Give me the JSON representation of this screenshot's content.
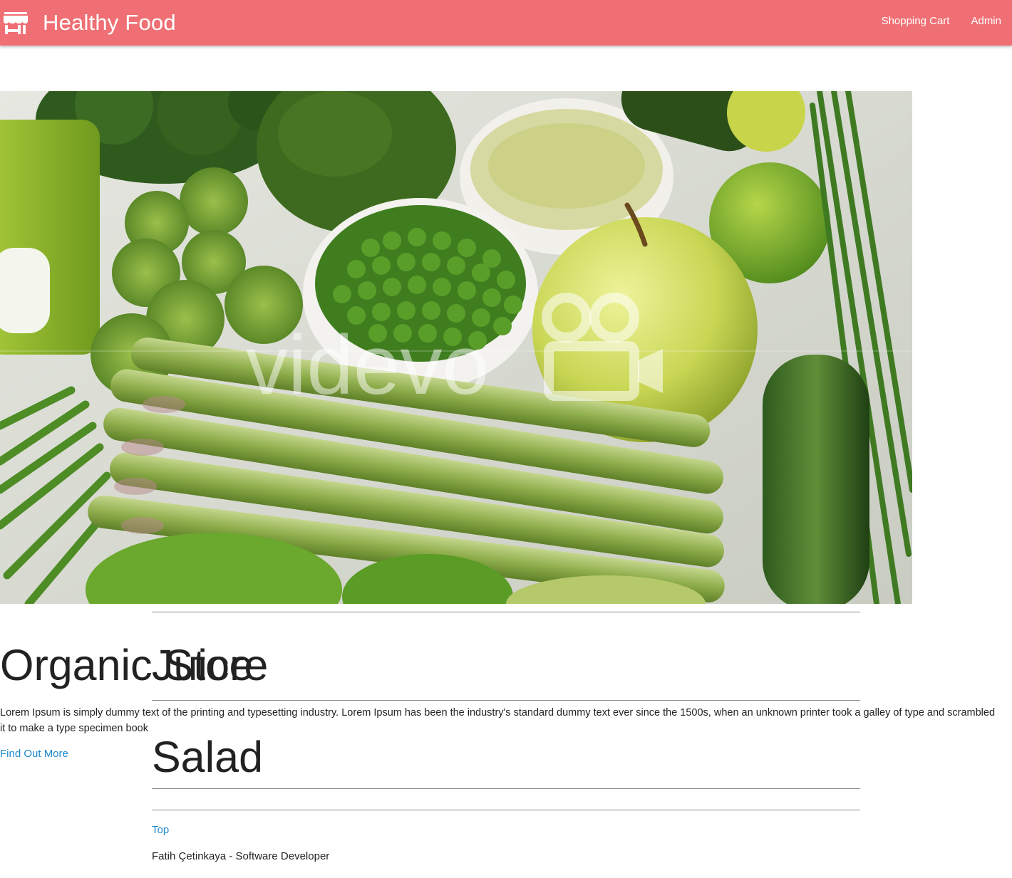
{
  "navbar": {
    "brand_icon": "store-icon",
    "title": "Healthy Food",
    "links": [
      {
        "label": "Shopping Cart"
      },
      {
        "label": "Admin"
      }
    ],
    "background_color": "#ef6f74"
  },
  "hero": {
    "watermark_text": "videvo",
    "watermark_icon": "video-camera-icon"
  },
  "sections": {
    "organic": {
      "heading": "Organic Store",
      "description": "Lorem Ipsum is simply dummy text of the printing and typesetting industry. Lorem Ipsum has been the industry's standard dummy text ever since the 1500s, when an unknown printer took a galley of type and scrambled it to make a type specimen book",
      "link": "Find Out More"
    },
    "juice": {
      "heading": "Juice"
    },
    "salad": {
      "heading": "Salad"
    }
  },
  "footer": {
    "top_link": "Top",
    "credit": "Fatih Çetinkaya - Software Developer"
  },
  "colors": {
    "accent": "#ef6f74",
    "link": "#1e88c9"
  }
}
